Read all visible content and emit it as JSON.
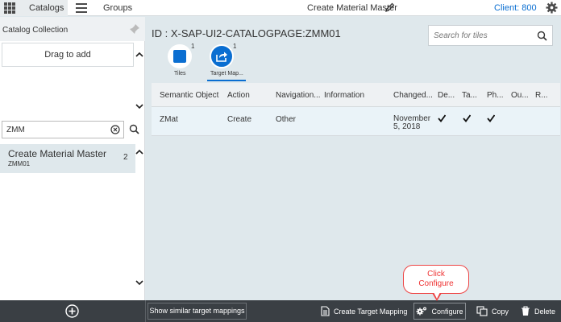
{
  "topbar": {
    "catalogs_tab": "Catalogs",
    "groups_tab": "Groups",
    "app_title": "Create Material Master",
    "client_label": "Client: 800"
  },
  "left_panel": {
    "catalog_collection_label": "Catalog Collection",
    "drag_to_add": "Drag to add",
    "search_value": "ZMM",
    "catalog_items": [
      {
        "title": "Create Material Master",
        "id": "ZMM01",
        "count": "2"
      }
    ]
  },
  "main": {
    "page_id": "ID : X-SAP-UI2-CATALOGPAGE:ZMM01",
    "search_placeholder": "Search for tiles",
    "tabs": [
      {
        "label": "Tiles",
        "badge": "1"
      },
      {
        "label": "Target Map...",
        "badge": "1"
      }
    ],
    "table": {
      "columns": [
        "Semantic Object",
        "Action",
        "Navigation...",
        "Information",
        "Changed...",
        "De...",
        "Ta...",
        "Ph...",
        "Ou...",
        "R..."
      ],
      "rows": [
        {
          "semantic_object": "ZMat",
          "action": "Create",
          "navigation": "Other",
          "information": "",
          "changed_line1": "November",
          "changed_line2": "5, 2018",
          "checks": [
            true,
            true,
            true,
            false,
            false
          ]
        }
      ]
    }
  },
  "bottombar": {
    "show_similar": "Show similar target mappings",
    "create_target_mapping": "Create Target Mapping",
    "configure": "Configure",
    "copy": "Copy",
    "delete": "Delete"
  },
  "callout": {
    "line1": "Click",
    "line2": "Configure"
  },
  "colors": {
    "accent": "#0a6ed1",
    "bottombar": "#3a3f44",
    "callout": "#e44444"
  }
}
